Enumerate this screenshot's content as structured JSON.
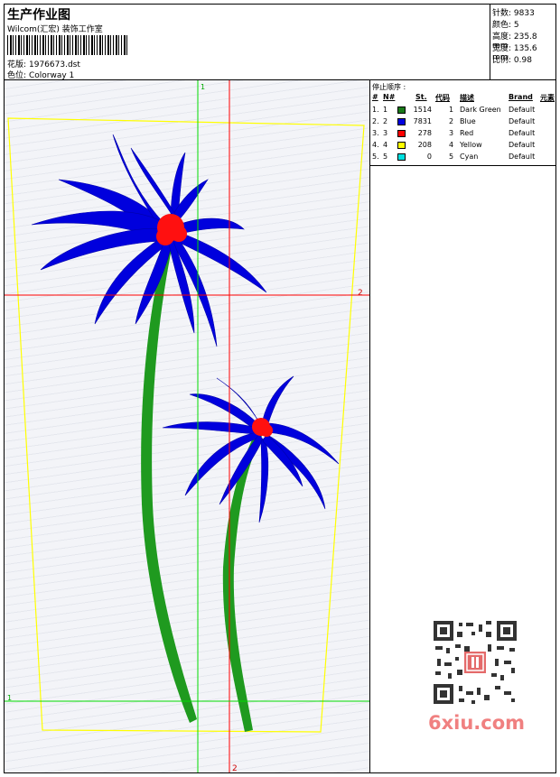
{
  "header": {
    "title": "生产作业图",
    "company": "Wilcom(汇宏) 装饰工作室",
    "design_label": "花版:",
    "design_value": "1976673.dst",
    "colorway_label": "色位:",
    "colorway_value": "Colorway 1"
  },
  "stats": {
    "stitches": "针数: 9833",
    "colors": "颜色: 5",
    "height": "高度: 235.8 mm",
    "width": "宽度: 135.6 mm",
    "scale": "比例: 0.98"
  },
  "stop_sequence": {
    "title": "停止顺序 :",
    "headers": [
      "#",
      "N#",
      "St.",
      "代码",
      "描述",
      "Brand",
      "元素"
    ],
    "rows": [
      {
        "idx": "1.",
        "n": "1",
        "st": "1514",
        "code": "1",
        "desc": "Dark Green",
        "brand": "Default",
        "color": "#1a7a1a"
      },
      {
        "idx": "2.",
        "n": "2",
        "st": "7831",
        "code": "2",
        "desc": "Blue",
        "brand": "Default",
        "color": "#0000e0"
      },
      {
        "idx": "3.",
        "n": "3",
        "st": "278",
        "code": "3",
        "desc": "Red",
        "brand": "Default",
        "color": "#ff0000"
      },
      {
        "idx": "4.",
        "n": "4",
        "st": "208",
        "code": "4",
        "desc": "Yellow",
        "brand": "Default",
        "color": "#ffff00"
      },
      {
        "idx": "5.",
        "n": "5",
        "st": "0",
        "code": "5",
        "desc": "Cyan",
        "brand": "Default",
        "color": "#00e0e0"
      }
    ]
  },
  "guides": {
    "v1_label": "1",
    "h2_label": "2",
    "h1_label": "1",
    "v2_label": "2"
  },
  "watermark": {
    "text": "6xiu.com"
  }
}
